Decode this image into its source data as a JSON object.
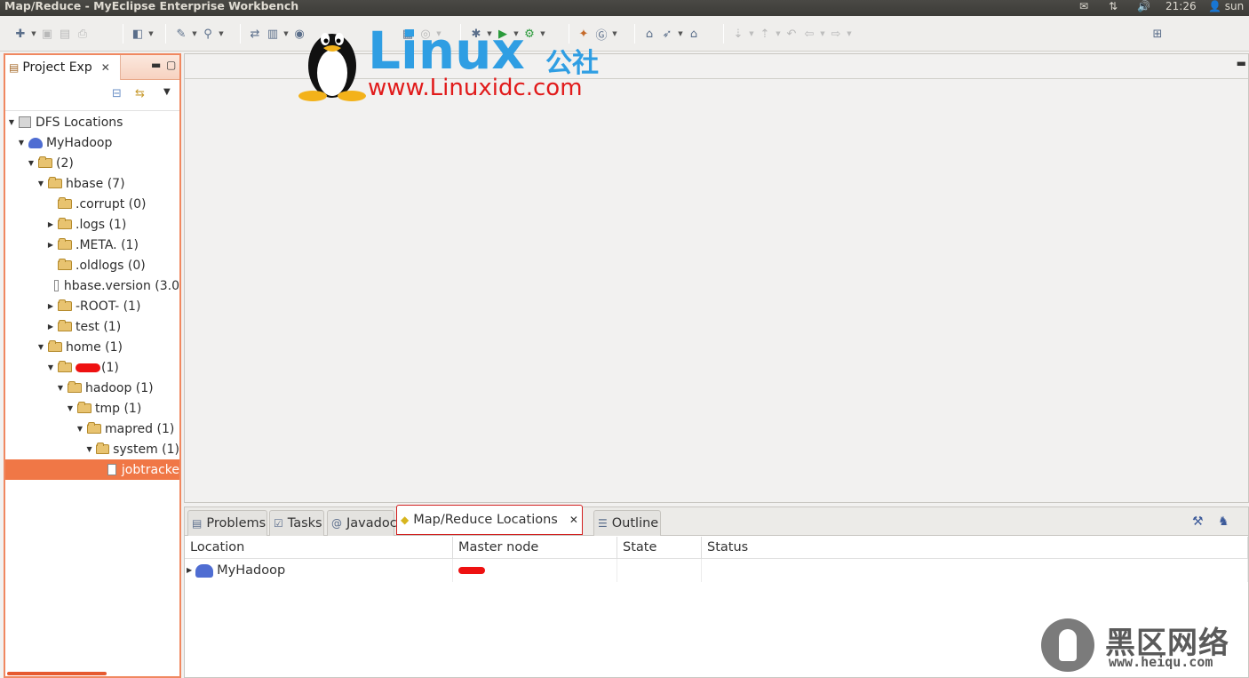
{
  "window": {
    "title": "Map/Reduce - MyEclipse Enterprise Workbench",
    "clock": "21:26",
    "user": "sun"
  },
  "explorer": {
    "tab_label": "Project Exp",
    "tree": [
      {
        "label": "DFS Locations",
        "expanded": true
      },
      {
        "label": "MyHadoop",
        "expanded": true
      },
      {
        "label": "(2)",
        "expanded": true
      },
      {
        "label": "hbase (7)",
        "expanded": true
      },
      {
        "label": ".corrupt (0)",
        "expanded": false
      },
      {
        "label": ".logs (1)",
        "expanded": false
      },
      {
        "label": ".META. (1)",
        "expanded": false
      },
      {
        "label": ".oldlogs (0)",
        "expanded": false
      },
      {
        "label": "hbase.version (3.0",
        "expanded": false
      },
      {
        "label": "-ROOT- (1)",
        "expanded": false
      },
      {
        "label": "test (1)",
        "expanded": false
      },
      {
        "label": "home (1)",
        "expanded": true
      },
      {
        "label": "(1)",
        "expanded": true
      },
      {
        "label": "hadoop (1)",
        "expanded": true
      },
      {
        "label": "tmp (1)",
        "expanded": true
      },
      {
        "label": "mapred (1)",
        "expanded": true
      },
      {
        "label": "system (1)",
        "expanded": true
      },
      {
        "label": "jobtracke",
        "expanded": false,
        "selected": true
      }
    ]
  },
  "watermark": {
    "linux": "Linux",
    "linux_cn": "公社",
    "linux_url": "www.Linuxidc.com",
    "heiqu_cn": "黑区网络",
    "heiqu_url": "www.heiqu.com"
  },
  "bottom_panel": {
    "tabs": [
      {
        "label": "Problems",
        "icon": "problems-icon"
      },
      {
        "label": "Tasks",
        "icon": "tasks-icon"
      },
      {
        "label": "Javadoc",
        "icon": "javadoc-icon"
      },
      {
        "label": "Map/Reduce Locations",
        "icon": "mapreduce-icon",
        "active": true
      },
      {
        "label": "Outline",
        "icon": "outline-icon"
      }
    ],
    "columns": [
      "Location",
      "Master node",
      "State",
      "Status"
    ],
    "rows": [
      {
        "location": "MyHadoop",
        "master_node": "",
        "state": "",
        "status": ""
      }
    ]
  },
  "colors": {
    "selection": "#f07746",
    "explorer_border": "#f08860",
    "active_tab_border": "#d21f1f",
    "linux_blue": "#2f9ee3",
    "linux_red": "#e11b1b",
    "redaction": "#ee1111"
  }
}
